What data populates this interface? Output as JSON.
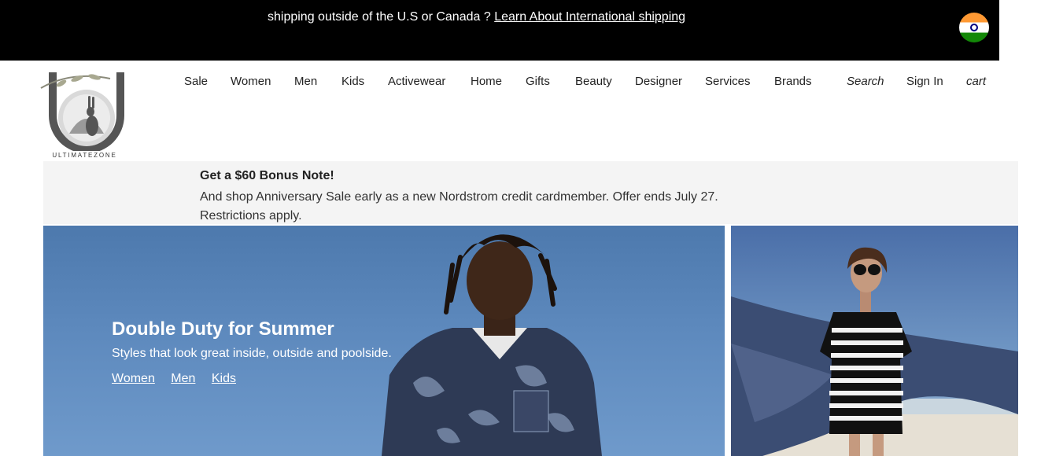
{
  "banner": {
    "message": "shipping outside of the U.S or Canada ? ",
    "link": "Learn About International shipping"
  },
  "logo": {
    "brand": "ULTIMATEZONE"
  },
  "nav": {
    "items": [
      "Sale",
      "Women",
      "Men",
      "Kids",
      "Activewear",
      "Home",
      "Gifts",
      "Beauty",
      "Designer",
      "Services",
      "Brands"
    ]
  },
  "utility": {
    "search": "Search",
    "sign_in": "Sign In",
    "cart": "cart"
  },
  "promo": {
    "title": "Get a $60 Bonus Note!",
    "body": "And shop Anniversary Sale early as a new Nordstrom credit cardmember. Offer ends July 27. Restrictions apply."
  },
  "hero": {
    "heading": "Double Duty for Summer",
    "subheading": "Styles that look great inside, outside and poolside.",
    "links": [
      "Women",
      "Men",
      "Kids"
    ]
  },
  "colors": {
    "banner_bg": "#000000",
    "promo_bg": "#f4f4f4",
    "sky": "#5d89bd"
  }
}
